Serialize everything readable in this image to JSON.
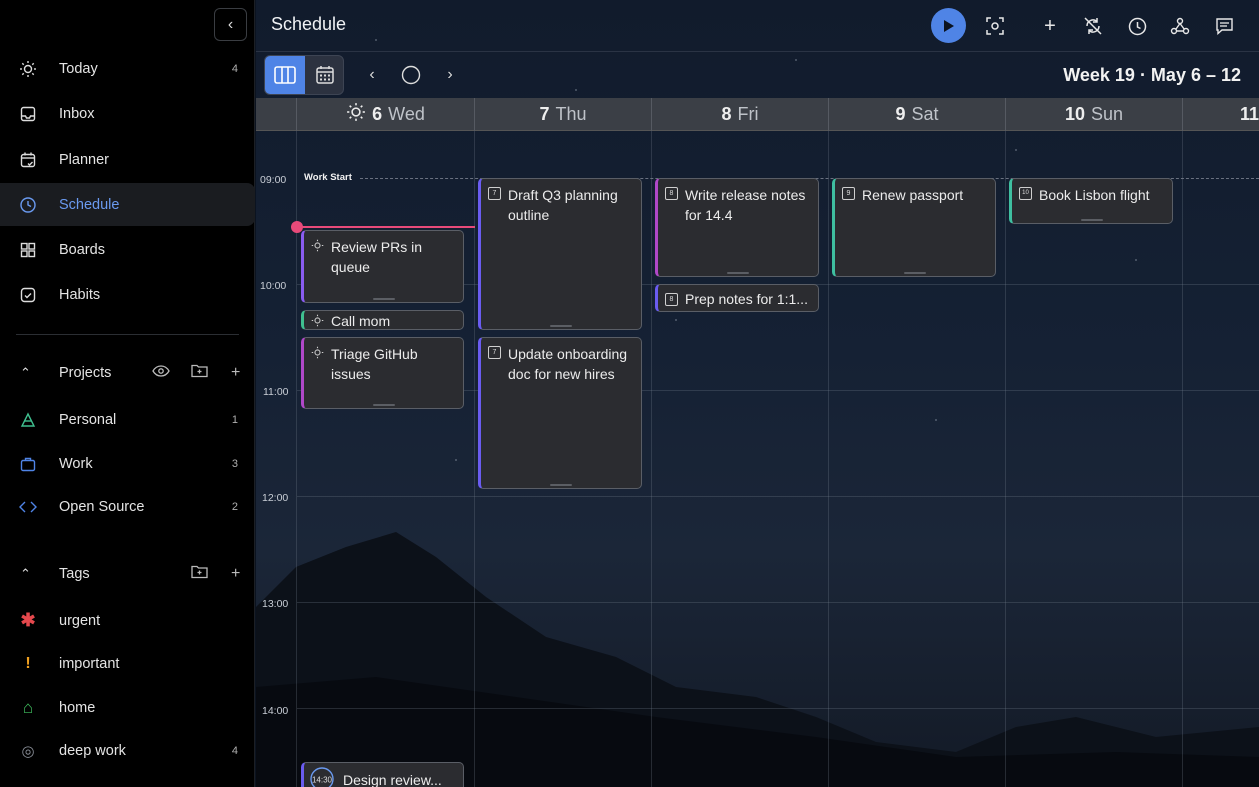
{
  "sidebar": {
    "nav": [
      {
        "label": "Today",
        "count": "4",
        "icon": "sun-icon"
      },
      {
        "label": "Inbox",
        "count": "",
        "icon": "inbox-icon"
      },
      {
        "label": "Planner",
        "count": "",
        "icon": "planner-icon"
      },
      {
        "label": "Schedule",
        "count": "",
        "icon": "clock-icon",
        "active": true
      },
      {
        "label": "Boards",
        "count": "",
        "icon": "boards-icon"
      },
      {
        "label": "Habits",
        "count": "",
        "icon": "habits-icon"
      }
    ],
    "projects": {
      "label": "Projects",
      "items": [
        {
          "label": "Personal",
          "count": "1",
          "color": "#3fbf8f"
        },
        {
          "label": "Work",
          "count": "3",
          "color": "#4f84e6"
        },
        {
          "label": "Open Source",
          "count": "2",
          "color": "#4f84e6"
        }
      ]
    },
    "tags": {
      "label": "Tags",
      "items": [
        {
          "label": "urgent",
          "count": "",
          "glyph": "✱",
          "color": "#e5484d"
        },
        {
          "label": "important",
          "count": "",
          "glyph": "!",
          "color": "#f0a020"
        },
        {
          "label": "home",
          "count": "",
          "glyph": "⌂",
          "color": "#3fbf5f"
        },
        {
          "label": "deep work",
          "count": "4",
          "glyph": "◎",
          "color": "#8a8f98"
        }
      ]
    }
  },
  "header": {
    "title": "Schedule",
    "week_label": "Week 19 · May 6 – 12"
  },
  "days": [
    {
      "num": "6",
      "name": "Wed",
      "today": true
    },
    {
      "num": "7",
      "name": "Thu"
    },
    {
      "num": "8",
      "name": "Fri"
    },
    {
      "num": "9",
      "name": "Sat"
    },
    {
      "num": "10",
      "name": "Sun"
    },
    {
      "num": "11",
      "name": ""
    }
  ],
  "hours": [
    "09:00",
    "10:00",
    "11:00",
    "12:00",
    "13:00",
    "14:00"
  ],
  "work_start_label": "Work Start",
  "tasks": [
    {
      "title": "Review PRs in queue",
      "icon": "sun",
      "color": "#8a5cf0"
    },
    {
      "title": "Call mom",
      "icon": "sun",
      "color": "#3fbf8f"
    },
    {
      "title": "Triage GitHub issues",
      "icon": "sun",
      "color": "#b048c8"
    },
    {
      "title": "Draft Q3 planning outline",
      "icon": "7",
      "color": "#6a5cf0"
    },
    {
      "title": "Update onboarding doc for new hires",
      "icon": "7",
      "color": "#6a5cf0"
    },
    {
      "title": "Write release notes for 14.4",
      "icon": "8",
      "color": "#b048c8"
    },
    {
      "title": "Prep notes for 1:1...",
      "icon": "8",
      "color": "#6a5cf0"
    },
    {
      "title": "Renew passport",
      "icon": "9",
      "color": "#3fbfa0"
    },
    {
      "title": "Book Lisbon flight",
      "icon": "10",
      "color": "#3fbfa0"
    },
    {
      "title": "Design review...",
      "icon": "14:30",
      "color": "#6a5cf0"
    }
  ]
}
